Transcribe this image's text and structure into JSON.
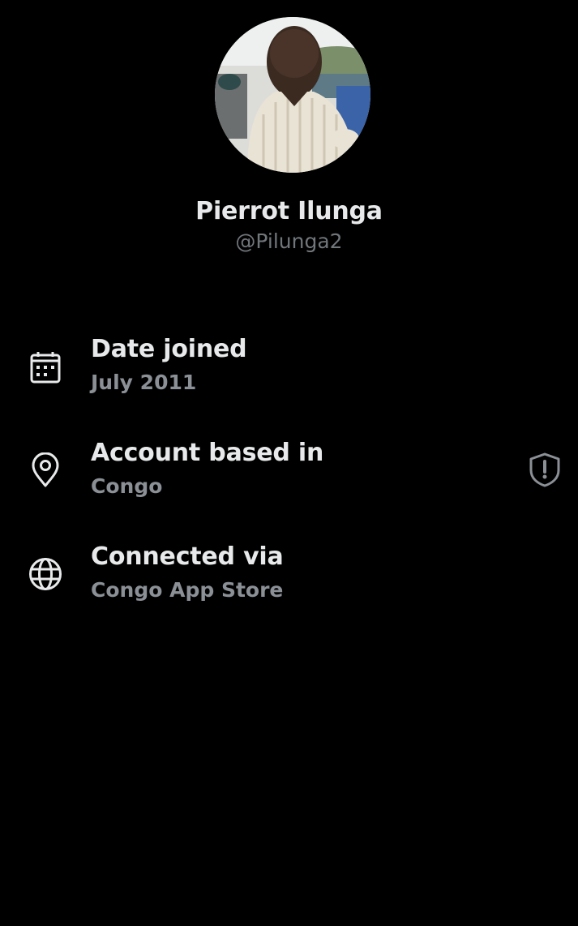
{
  "profile": {
    "display_name": "Pierrot Ilunga",
    "handle": "@Pilunga2"
  },
  "info": {
    "date_joined": {
      "label": "Date joined",
      "value": "July 2011",
      "icon": "calendar-icon"
    },
    "account_based_in": {
      "label": "Account based in",
      "value": "Congo",
      "icon": "location-pin-icon",
      "badge_icon": "shield-alert-icon"
    },
    "connected_via": {
      "label": "Connected via",
      "value": "Congo App Store",
      "icon": "globe-icon"
    }
  },
  "colors": {
    "background": "#000000",
    "primary_text": "#e7e9ea",
    "secondary_text": "#8b9096",
    "handle_text": "#71767b"
  }
}
